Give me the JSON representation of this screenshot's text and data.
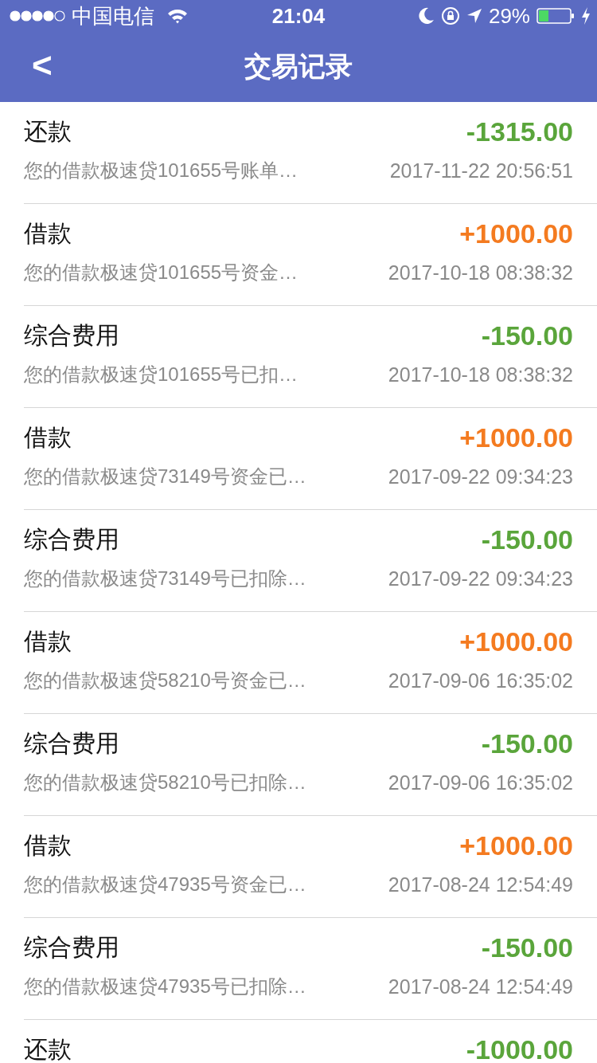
{
  "status_bar": {
    "carrier": "中国电信",
    "time": "21:04",
    "battery": "29%"
  },
  "nav": {
    "back": "<",
    "title": "交易记录"
  },
  "transactions": [
    {
      "title": "还款",
      "amount": "-1315.00",
      "color": "#5aa53b",
      "description": "您的借款极速贷101655号账单…",
      "time": "2017-11-22 20:56:51"
    },
    {
      "title": "借款",
      "amount": "+1000.00",
      "color": "#f47b20",
      "description": "您的借款极速贷101655号资金…",
      "time": "2017-10-18 08:38:32"
    },
    {
      "title": "综合费用",
      "amount": "-150.00",
      "color": "#5aa53b",
      "description": "您的借款极速贷101655号已扣…",
      "time": "2017-10-18 08:38:32"
    },
    {
      "title": "借款",
      "amount": "+1000.00",
      "color": "#f47b20",
      "description": "您的借款极速贷73149号资金已…",
      "time": "2017-09-22 09:34:23"
    },
    {
      "title": "综合费用",
      "amount": "-150.00",
      "color": "#5aa53b",
      "description": "您的借款极速贷73149号已扣除…",
      "time": "2017-09-22 09:34:23"
    },
    {
      "title": "借款",
      "amount": "+1000.00",
      "color": "#f47b20",
      "description": "您的借款极速贷58210号资金已…",
      "time": "2017-09-06 16:35:02"
    },
    {
      "title": "综合费用",
      "amount": "-150.00",
      "color": "#5aa53b",
      "description": "您的借款极速贷58210号已扣除…",
      "time": "2017-09-06 16:35:02"
    },
    {
      "title": "借款",
      "amount": "+1000.00",
      "color": "#f47b20",
      "description": "您的借款极速贷47935号资金已…",
      "time": "2017-08-24 12:54:49"
    },
    {
      "title": "综合费用",
      "amount": "-150.00",
      "color": "#5aa53b",
      "description": "您的借款极速贷47935号已扣除…",
      "time": "2017-08-24 12:54:49"
    },
    {
      "title": "还款",
      "amount": "-1000.00",
      "color": "#5aa53b"
    }
  ]
}
